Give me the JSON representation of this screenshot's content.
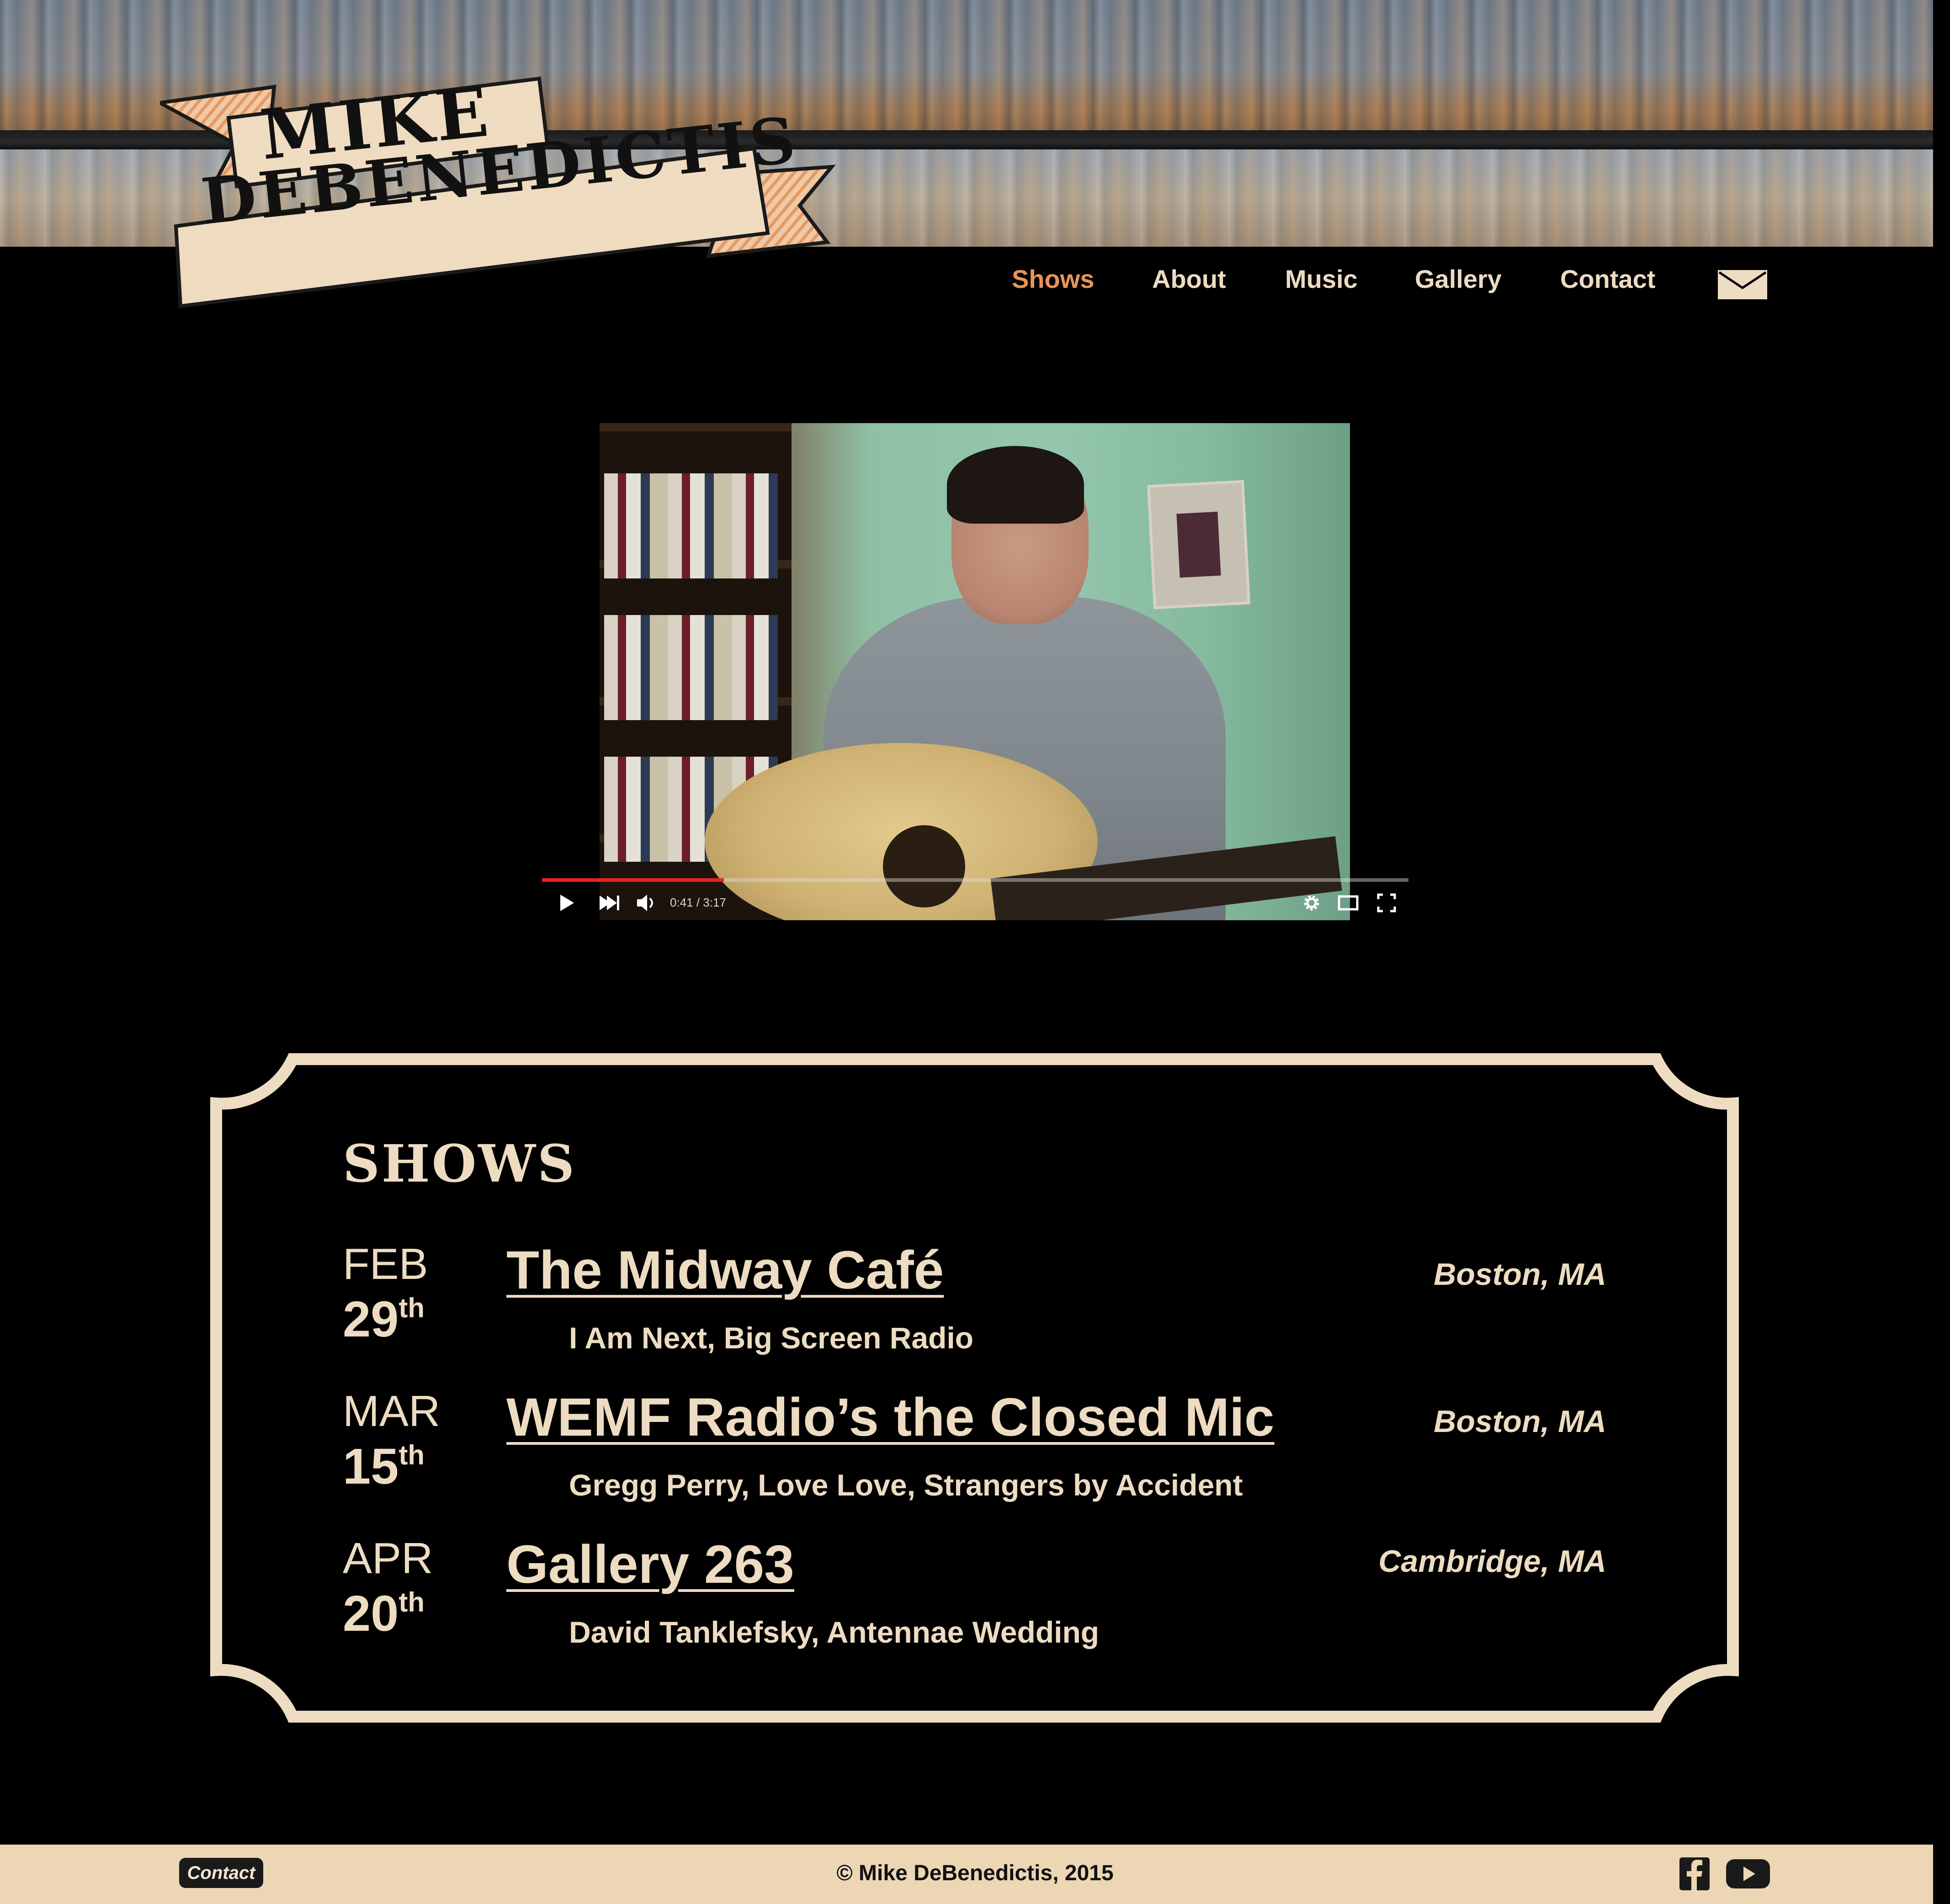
{
  "site": {
    "logo_line1": "MIKE",
    "logo_line2": "DEBENEDICTIS"
  },
  "nav": {
    "items": [
      {
        "label": "Shows",
        "active": true
      },
      {
        "label": "About",
        "active": false
      },
      {
        "label": "Music",
        "active": false
      },
      {
        "label": "Gallery",
        "active": false
      },
      {
        "label": "Contact",
        "active": false
      }
    ],
    "mail_icon": "envelope-icon"
  },
  "video": {
    "time": "0:41 / 3:17",
    "progress_fraction": 0.21,
    "controls": [
      "play-icon",
      "next-icon",
      "volume-icon",
      "settings-icon",
      "theater-icon",
      "fullscreen-icon"
    ]
  },
  "shows": {
    "title": "SHOWS",
    "items": [
      {
        "month": "FEB",
        "day": "29",
        "suffix": "th",
        "venue": "The Midway Café",
        "acts": "I Am Next, Big Screen Radio",
        "city": "Boston, MA"
      },
      {
        "month": "MAR",
        "day": "15",
        "suffix": "th",
        "venue": "WEMF Radio’s the Closed Mic",
        "acts": "Gregg Perry, Love Love, Strangers by Accident",
        "city": "Boston, MA"
      },
      {
        "month": "APR",
        "day": "20",
        "suffix": "th",
        "venue": "Gallery 263",
        "acts": "David Tanklefsky, Antennae Wedding",
        "city": "Cambridge, MA"
      }
    ]
  },
  "footer": {
    "contact_label": "Contact",
    "copyright": "© Mike DeBenedictis, 2015",
    "social": [
      "facebook-icon",
      "youtube-icon"
    ]
  },
  "colors": {
    "background": "#000000",
    "cream": "#eddcc2",
    "accent": "#e7955a",
    "footer": "#ecd6b4",
    "progress": "#e52421"
  }
}
